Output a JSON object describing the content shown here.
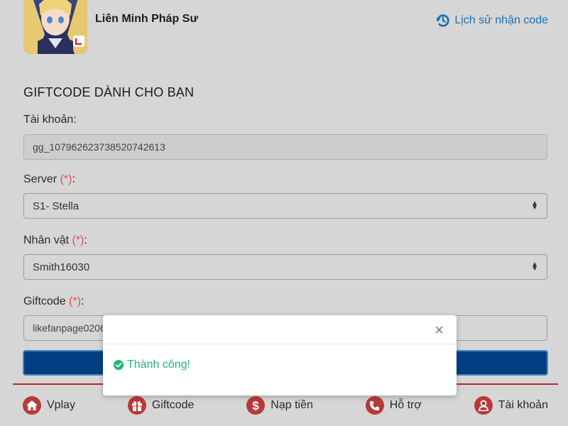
{
  "header": {
    "game_name": "Liên Minh Pháp Sư",
    "history_link": "Lịch sử nhận code",
    "history_icon": "history-icon"
  },
  "form": {
    "title": "GIFTCODE DÀNH CHO BẠN",
    "account_label": "Tài khoản:",
    "account_value": "gg_107962623738520742613",
    "server_label": "Server",
    "server_value": "S1- Stella",
    "character_label": "Nhân vật",
    "character_value": "Smith16030",
    "giftcode_label": "Giftcode",
    "giftcode_value": "likefanpage0206",
    "required_mark": "(*)",
    "colon": ":"
  },
  "bottom_nav": [
    {
      "label": "Vplay",
      "icon": "home-icon"
    },
    {
      "label": "Giftcode",
      "icon": "gift-icon"
    },
    {
      "label": "Nạp tiền",
      "icon": "dollar-icon"
    },
    {
      "label": "Hỗ trợ",
      "icon": "phone-icon"
    },
    {
      "label": "Tài khoản",
      "icon": "user-icon"
    }
  ],
  "modal": {
    "close_glyph": "×",
    "message": "Thành công!",
    "icon": "check-circle-icon"
  },
  "colors": {
    "accent_blue": "#1a73b8",
    "button_blue": "#023f82",
    "nav_red": "#b83939",
    "success_green": "#22b573",
    "required_red": "#d9534f"
  }
}
